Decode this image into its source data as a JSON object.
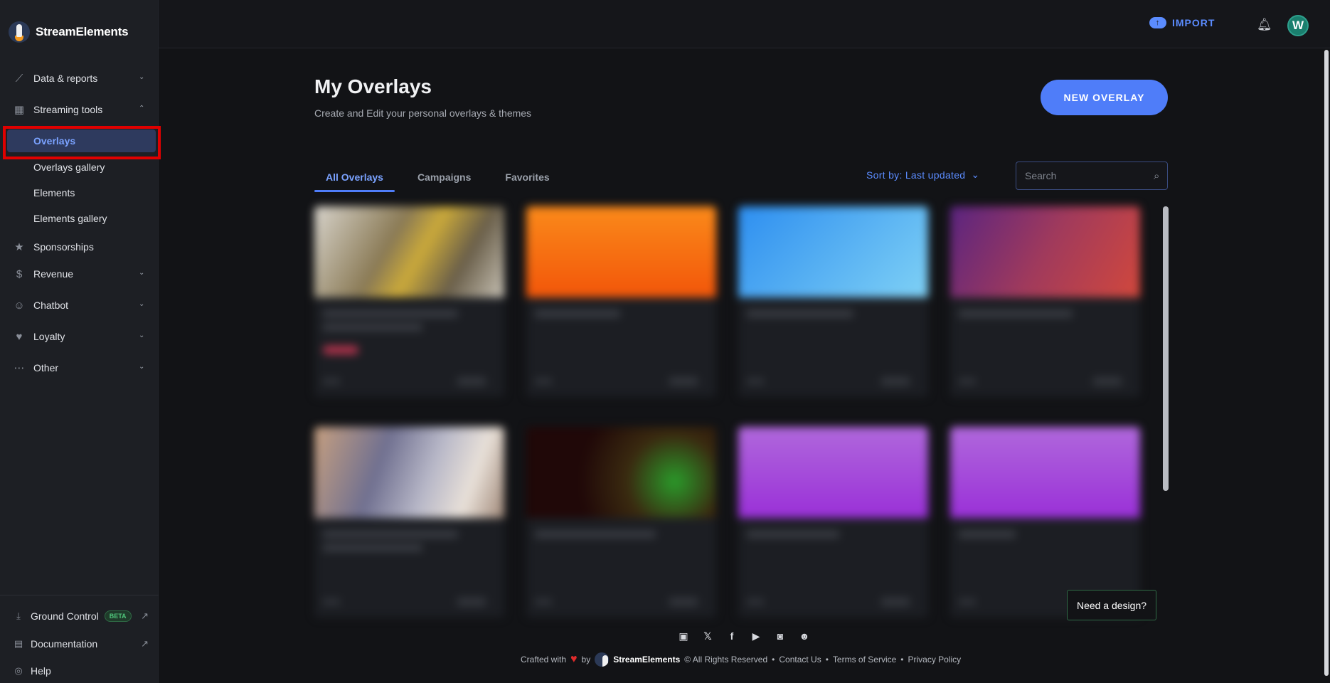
{
  "brand": {
    "name": "StreamElements"
  },
  "sidebar": {
    "items": [
      {
        "label": "Data & reports",
        "icon": "chart-line-icon"
      },
      {
        "label": "Streaming tools",
        "icon": "layout-icon"
      },
      {
        "label": "Sponsorships",
        "icon": "star-icon"
      },
      {
        "label": "Revenue",
        "icon": "dollar-icon"
      },
      {
        "label": "Chatbot",
        "icon": "robot-icon"
      },
      {
        "label": "Loyalty",
        "icon": "loyalty-icon"
      },
      {
        "label": "Other",
        "icon": "dots-icon"
      }
    ],
    "streaming_sub": [
      {
        "label": "Overlays",
        "active": true
      },
      {
        "label": "Overlays gallery"
      },
      {
        "label": "Elements"
      },
      {
        "label": "Elements gallery"
      }
    ],
    "bottom": {
      "ground_control": "Ground Control",
      "beta": "BETA",
      "documentation": "Documentation",
      "help": "Help"
    }
  },
  "topbar": {
    "import_label": "IMPORT",
    "avatar_letter": "W"
  },
  "main": {
    "title": "My Overlays",
    "subtitle": "Create and Edit your personal overlays & themes",
    "new_button": "NEW OVERLAY",
    "tabs": [
      "All Overlays",
      "Campaigns",
      "Favorites"
    ],
    "sort_label": "Sort by: Last updated",
    "search_placeholder": "Search"
  },
  "footer": {
    "crafted": "Crafted with",
    "by": "by",
    "brand": "StreamElements",
    "rights": "© All Rights Reserved",
    "contact": "Contact Us",
    "terms": "Terms of Service",
    "privacy": "Privacy Policy",
    "socials": [
      "twitch-icon",
      "x-icon",
      "facebook-icon",
      "youtube-icon",
      "instagram-icon",
      "discord-icon"
    ]
  },
  "need_design": "Need a design?",
  "colors": {
    "accent": "#4f7df9",
    "highlight_box": "#e00000",
    "card_thumbs": [
      "#8a7a55",
      "#f26a10",
      "#45a8ea",
      "#a03a5c",
      "#8c8aa0",
      "#4a2a14",
      "#b04ad8",
      "#b04ad8"
    ]
  }
}
